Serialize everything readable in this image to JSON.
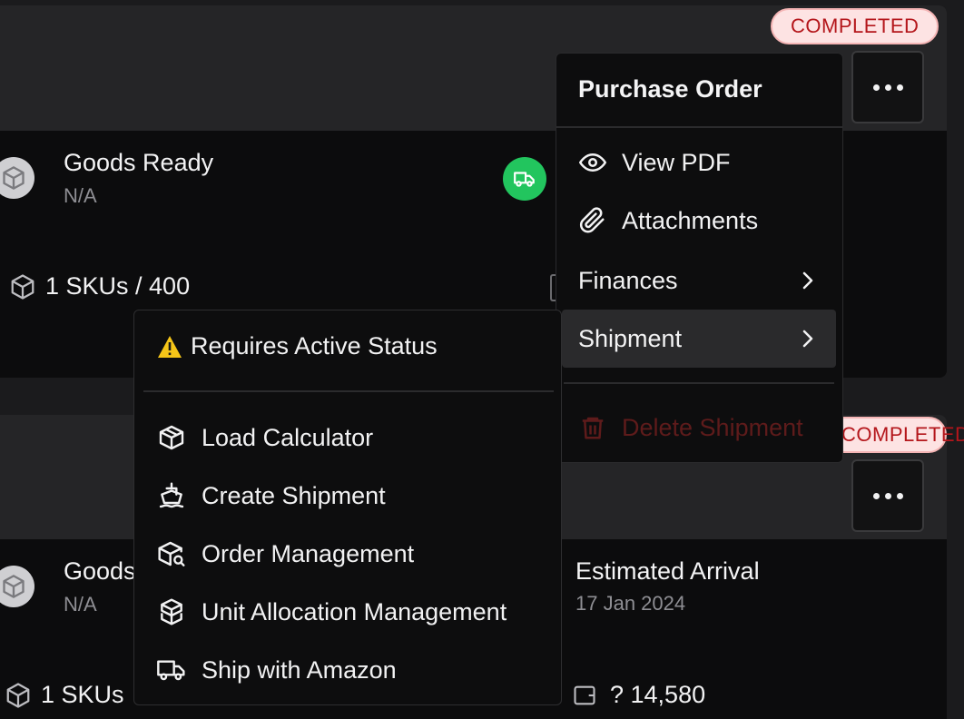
{
  "cards": [
    {
      "status": "COMPLETED",
      "title": "Goods Ready",
      "subtitle": "N/A",
      "sku": "1 SKUs / 400"
    },
    {
      "status": "COMPLETED",
      "title": "Goods",
      "subtitle": "N/A",
      "sku": "1 SKUs",
      "arrival_label": "Estimated Arrival",
      "arrival_date": "17 Jan 2024",
      "price": "? 14,580"
    }
  ],
  "menu": {
    "header": "Purchase Order",
    "items": [
      {
        "label": "View PDF",
        "icon": "eye-icon"
      },
      {
        "label": "Attachments",
        "icon": "paperclip-icon"
      },
      {
        "label": "Finances",
        "icon": "chevron-right-icon"
      },
      {
        "label": "Shipment",
        "icon": "chevron-right-icon"
      },
      {
        "label": "Delete Shipment",
        "icon": "trash-icon"
      }
    ]
  },
  "submenu": {
    "warning": "Requires Active Status",
    "items": [
      {
        "label": "Load Calculator",
        "icon": "box-icon"
      },
      {
        "label": "Create Shipment",
        "icon": "ship-icon"
      },
      {
        "label": "Order Management",
        "icon": "box-search-icon"
      },
      {
        "label": "Unit Allocation Management",
        "icon": "boxes-icon"
      },
      {
        "label": "Ship with Amazon",
        "icon": "truck-icon"
      }
    ]
  },
  "colors": {
    "badge_text": "#b4161b",
    "badge_bg": "#fde3e3",
    "truck_green": "#22c55e",
    "delete_red": "#5e1b1b",
    "warning_yellow": "#f5c518"
  }
}
